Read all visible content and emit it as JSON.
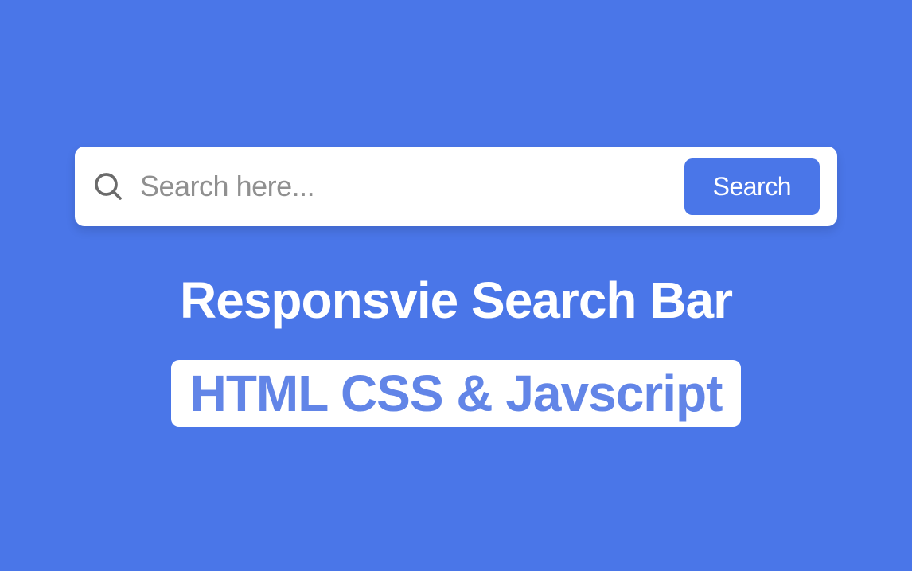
{
  "search": {
    "placeholder": "Search here...",
    "button_label": "Search"
  },
  "heading": "Responsvie Search Bar",
  "subheading": "HTML CSS & Javscript",
  "colors": {
    "background": "#4A76E8",
    "white": "#FFFFFF",
    "placeholder": "#909090",
    "subheading_text": "#6285E7"
  }
}
